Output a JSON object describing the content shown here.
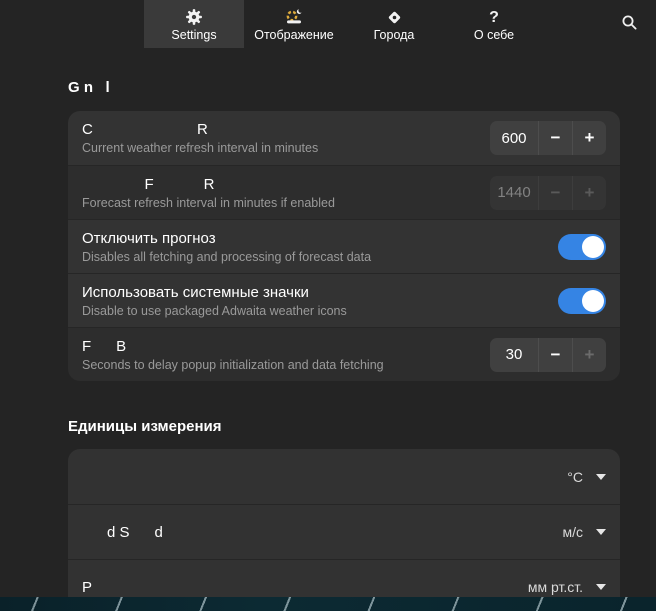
{
  "header": {
    "tabs": [
      {
        "label": "Settings",
        "icon": "gear-icon",
        "selected": true
      },
      {
        "label": "Отображение",
        "icon": "appearance-icon",
        "selected": false
      },
      {
        "label": "Города",
        "icon": "cities-icon",
        "selected": false
      },
      {
        "label": "О себе",
        "icon": "question-icon",
        "selected": false
      }
    ],
    "question_glyph": "?"
  },
  "general": {
    "section_title": "G n   l",
    "rows": [
      {
        "title": "C                         R",
        "subtitle": "Current weather refresh interval in minutes",
        "control": "spinbutton",
        "value": "600",
        "enabled": true
      },
      {
        "title": "               F            R",
        "subtitle": "Forecast refresh interval in minutes if enabled",
        "control": "spinbutton",
        "value": "1440",
        "enabled": false
      },
      {
        "title": "Отключить прогноз",
        "subtitle": "Disables all fetching and processing of forecast data",
        "control": "switch",
        "state": "on"
      },
      {
        "title": "Использовать системные значки",
        "subtitle": "Disable to use packaged Adwaita weather icons",
        "control": "switch",
        "state": "on"
      },
      {
        "title": "F      B",
        "subtitle": "Seconds to delay popup initialization and data fetching",
        "control": "spinbutton",
        "value": "30",
        "enabled": true,
        "plus_enabled": false
      }
    ]
  },
  "units": {
    "section_title": "Единицы измерения",
    "rows": [
      {
        "title": "",
        "control": "dropdown",
        "value": "°C"
      },
      {
        "title": "      d S      d",
        "control": "dropdown",
        "value": "м/с"
      },
      {
        "title": "P",
        "control": "dropdown",
        "value": "мм рт.ст."
      }
    ]
  },
  "glyphs": {
    "minus": "−",
    "plus": "+"
  },
  "colors": {
    "accent": "#3584e4",
    "window_bg": "#242424",
    "row_bg": "#333333",
    "row_bg_dim": "#2d2d2d",
    "appearance_icon_yellow": "#dcaa3c"
  }
}
